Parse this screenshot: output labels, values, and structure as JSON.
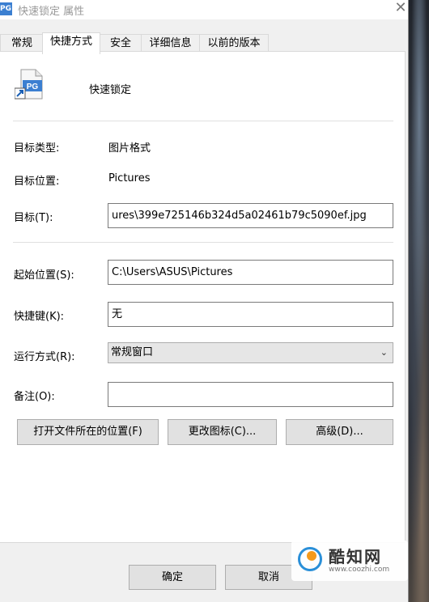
{
  "window": {
    "title": "快速锁定 属性",
    "title_icon_text": "PG",
    "close_glyph": "✕"
  },
  "tabs": [
    {
      "label": "常规",
      "active": false
    },
    {
      "label": "快捷方式",
      "active": true
    },
    {
      "label": "安全",
      "active": false
    },
    {
      "label": "详细信息",
      "active": false
    },
    {
      "label": "以前的版本",
      "active": false
    }
  ],
  "shortcut": {
    "icon_text": "PG",
    "name": "快速锁定",
    "target_type_label": "目标类型:",
    "target_type_value": "图片格式",
    "target_location_label": "目标位置:",
    "target_location_value": "Pictures",
    "target_label": "目标(T):",
    "target_value": "ures\\399e725146b324d5a02461b79c5090ef.jpg",
    "start_in_label": "起始位置(S):",
    "start_in_value": "C:\\Users\\ASUS\\Pictures",
    "hotkey_label": "快捷键(K):",
    "hotkey_value": "无",
    "run_label": "运行方式(R):",
    "run_value": "常规窗口",
    "comment_label": "备注(O):",
    "comment_value": ""
  },
  "buttons": {
    "open_location": "打开文件所在的位置(F)",
    "change_icon": "更改图标(C)...",
    "advanced": "高级(D)...",
    "ok": "确定",
    "cancel": "取消"
  },
  "watermark": {
    "name": "酷知网",
    "url": "www.coozhi.com"
  },
  "colors": {
    "icon_blue": "#3b7fd1",
    "logo_blue": "#2a8fd8",
    "logo_orange": "#f59a1c"
  }
}
